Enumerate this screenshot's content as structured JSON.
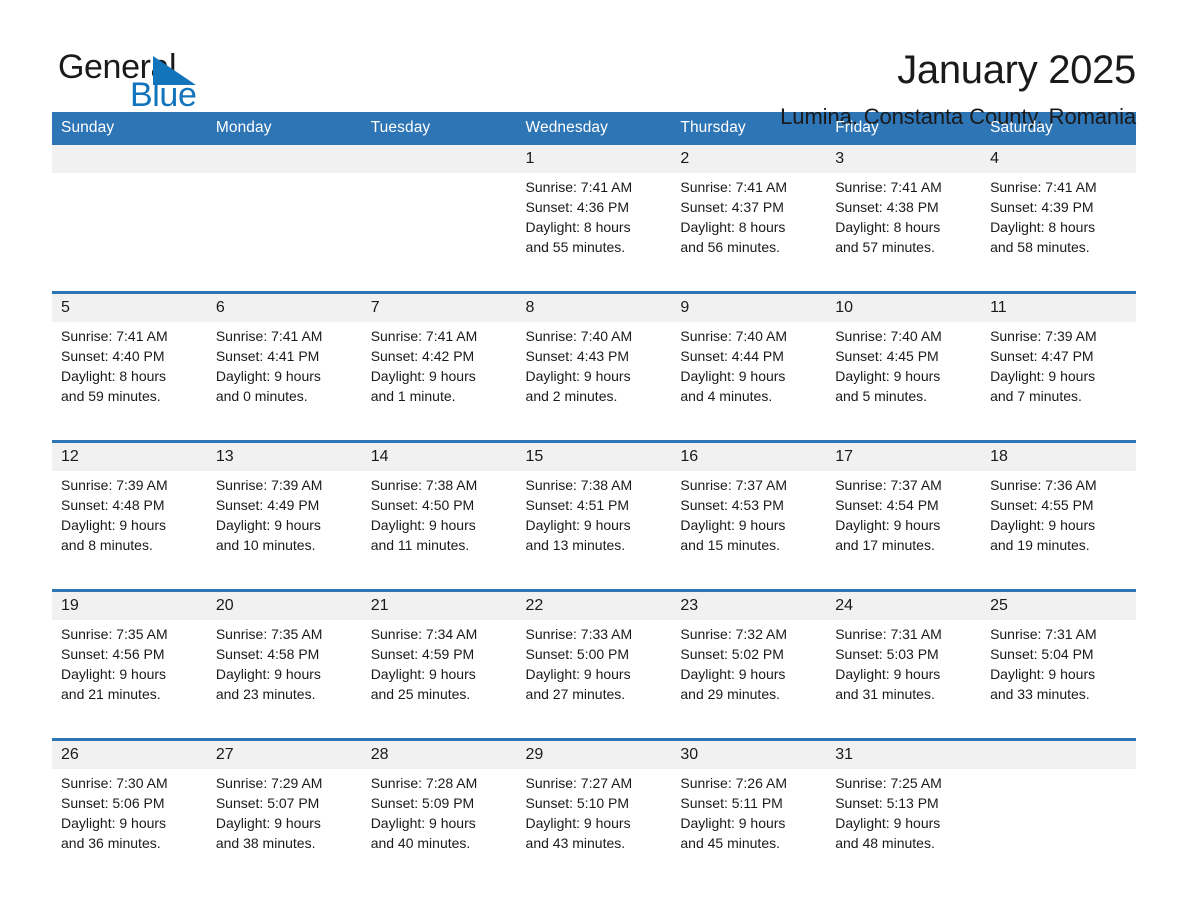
{
  "brand": {
    "name_part1": "General",
    "name_part2": "Blue",
    "triangle_color": "#1275bc"
  },
  "header": {
    "title": "January 2025",
    "subtitle": "Lumina, Constanta County, Romania"
  },
  "theme": {
    "header_blue": "#2e75b6",
    "date_band_gray": "#f1f1f1",
    "text": "#1a1a1a"
  },
  "weekdays": [
    "Sunday",
    "Monday",
    "Tuesday",
    "Wednesday",
    "Thursday",
    "Friday",
    "Saturday"
  ],
  "weeks": [
    {
      "numbers": [
        "",
        "",
        "",
        "1",
        "2",
        "3",
        "4"
      ],
      "cells": [
        {
          "sunrise": "",
          "sunset": "",
          "daylight1": "",
          "daylight2": ""
        },
        {
          "sunrise": "",
          "sunset": "",
          "daylight1": "",
          "daylight2": ""
        },
        {
          "sunrise": "",
          "sunset": "",
          "daylight1": "",
          "daylight2": ""
        },
        {
          "sunrise": "Sunrise: 7:41 AM",
          "sunset": "Sunset: 4:36 PM",
          "daylight1": "Daylight: 8 hours",
          "daylight2": "and 55 minutes."
        },
        {
          "sunrise": "Sunrise: 7:41 AM",
          "sunset": "Sunset: 4:37 PM",
          "daylight1": "Daylight: 8 hours",
          "daylight2": "and 56 minutes."
        },
        {
          "sunrise": "Sunrise: 7:41 AM",
          "sunset": "Sunset: 4:38 PM",
          "daylight1": "Daylight: 8 hours",
          "daylight2": "and 57 minutes."
        },
        {
          "sunrise": "Sunrise: 7:41 AM",
          "sunset": "Sunset: 4:39 PM",
          "daylight1": "Daylight: 8 hours",
          "daylight2": "and 58 minutes."
        }
      ]
    },
    {
      "numbers": [
        "5",
        "6",
        "7",
        "8",
        "9",
        "10",
        "11"
      ],
      "cells": [
        {
          "sunrise": "Sunrise: 7:41 AM",
          "sunset": "Sunset: 4:40 PM",
          "daylight1": "Daylight: 8 hours",
          "daylight2": "and 59 minutes."
        },
        {
          "sunrise": "Sunrise: 7:41 AM",
          "sunset": "Sunset: 4:41 PM",
          "daylight1": "Daylight: 9 hours",
          "daylight2": "and 0 minutes."
        },
        {
          "sunrise": "Sunrise: 7:41 AM",
          "sunset": "Sunset: 4:42 PM",
          "daylight1": "Daylight: 9 hours",
          "daylight2": "and 1 minute."
        },
        {
          "sunrise": "Sunrise: 7:40 AM",
          "sunset": "Sunset: 4:43 PM",
          "daylight1": "Daylight: 9 hours",
          "daylight2": "and 2 minutes."
        },
        {
          "sunrise": "Sunrise: 7:40 AM",
          "sunset": "Sunset: 4:44 PM",
          "daylight1": "Daylight: 9 hours",
          "daylight2": "and 4 minutes."
        },
        {
          "sunrise": "Sunrise: 7:40 AM",
          "sunset": "Sunset: 4:45 PM",
          "daylight1": "Daylight: 9 hours",
          "daylight2": "and 5 minutes."
        },
        {
          "sunrise": "Sunrise: 7:39 AM",
          "sunset": "Sunset: 4:47 PM",
          "daylight1": "Daylight: 9 hours",
          "daylight2": "and 7 minutes."
        }
      ]
    },
    {
      "numbers": [
        "12",
        "13",
        "14",
        "15",
        "16",
        "17",
        "18"
      ],
      "cells": [
        {
          "sunrise": "Sunrise: 7:39 AM",
          "sunset": "Sunset: 4:48 PM",
          "daylight1": "Daylight: 9 hours",
          "daylight2": "and 8 minutes."
        },
        {
          "sunrise": "Sunrise: 7:39 AM",
          "sunset": "Sunset: 4:49 PM",
          "daylight1": "Daylight: 9 hours",
          "daylight2": "and 10 minutes."
        },
        {
          "sunrise": "Sunrise: 7:38 AM",
          "sunset": "Sunset: 4:50 PM",
          "daylight1": "Daylight: 9 hours",
          "daylight2": "and 11 minutes."
        },
        {
          "sunrise": "Sunrise: 7:38 AM",
          "sunset": "Sunset: 4:51 PM",
          "daylight1": "Daylight: 9 hours",
          "daylight2": "and 13 minutes."
        },
        {
          "sunrise": "Sunrise: 7:37 AM",
          "sunset": "Sunset: 4:53 PM",
          "daylight1": "Daylight: 9 hours",
          "daylight2": "and 15 minutes."
        },
        {
          "sunrise": "Sunrise: 7:37 AM",
          "sunset": "Sunset: 4:54 PM",
          "daylight1": "Daylight: 9 hours",
          "daylight2": "and 17 minutes."
        },
        {
          "sunrise": "Sunrise: 7:36 AM",
          "sunset": "Sunset: 4:55 PM",
          "daylight1": "Daylight: 9 hours",
          "daylight2": "and 19 minutes."
        }
      ]
    },
    {
      "numbers": [
        "19",
        "20",
        "21",
        "22",
        "23",
        "24",
        "25"
      ],
      "cells": [
        {
          "sunrise": "Sunrise: 7:35 AM",
          "sunset": "Sunset: 4:56 PM",
          "daylight1": "Daylight: 9 hours",
          "daylight2": "and 21 minutes."
        },
        {
          "sunrise": "Sunrise: 7:35 AM",
          "sunset": "Sunset: 4:58 PM",
          "daylight1": "Daylight: 9 hours",
          "daylight2": "and 23 minutes."
        },
        {
          "sunrise": "Sunrise: 7:34 AM",
          "sunset": "Sunset: 4:59 PM",
          "daylight1": "Daylight: 9 hours",
          "daylight2": "and 25 minutes."
        },
        {
          "sunrise": "Sunrise: 7:33 AM",
          "sunset": "Sunset: 5:00 PM",
          "daylight1": "Daylight: 9 hours",
          "daylight2": "and 27 minutes."
        },
        {
          "sunrise": "Sunrise: 7:32 AM",
          "sunset": "Sunset: 5:02 PM",
          "daylight1": "Daylight: 9 hours",
          "daylight2": "and 29 minutes."
        },
        {
          "sunrise": "Sunrise: 7:31 AM",
          "sunset": "Sunset: 5:03 PM",
          "daylight1": "Daylight: 9 hours",
          "daylight2": "and 31 minutes."
        },
        {
          "sunrise": "Sunrise: 7:31 AM",
          "sunset": "Sunset: 5:04 PM",
          "daylight1": "Daylight: 9 hours",
          "daylight2": "and 33 minutes."
        }
      ]
    },
    {
      "numbers": [
        "26",
        "27",
        "28",
        "29",
        "30",
        "31",
        ""
      ],
      "cells": [
        {
          "sunrise": "Sunrise: 7:30 AM",
          "sunset": "Sunset: 5:06 PM",
          "daylight1": "Daylight: 9 hours",
          "daylight2": "and 36 minutes."
        },
        {
          "sunrise": "Sunrise: 7:29 AM",
          "sunset": "Sunset: 5:07 PM",
          "daylight1": "Daylight: 9 hours",
          "daylight2": "and 38 minutes."
        },
        {
          "sunrise": "Sunrise: 7:28 AM",
          "sunset": "Sunset: 5:09 PM",
          "daylight1": "Daylight: 9 hours",
          "daylight2": "and 40 minutes."
        },
        {
          "sunrise": "Sunrise: 7:27 AM",
          "sunset": "Sunset: 5:10 PM",
          "daylight1": "Daylight: 9 hours",
          "daylight2": "and 43 minutes."
        },
        {
          "sunrise": "Sunrise: 7:26 AM",
          "sunset": "Sunset: 5:11 PM",
          "daylight1": "Daylight: 9 hours",
          "daylight2": "and 45 minutes."
        },
        {
          "sunrise": "Sunrise: 7:25 AM",
          "sunset": "Sunset: 5:13 PM",
          "daylight1": "Daylight: 9 hours",
          "daylight2": "and 48 minutes."
        },
        {
          "sunrise": "",
          "sunset": "",
          "daylight1": "",
          "daylight2": ""
        }
      ]
    }
  ]
}
